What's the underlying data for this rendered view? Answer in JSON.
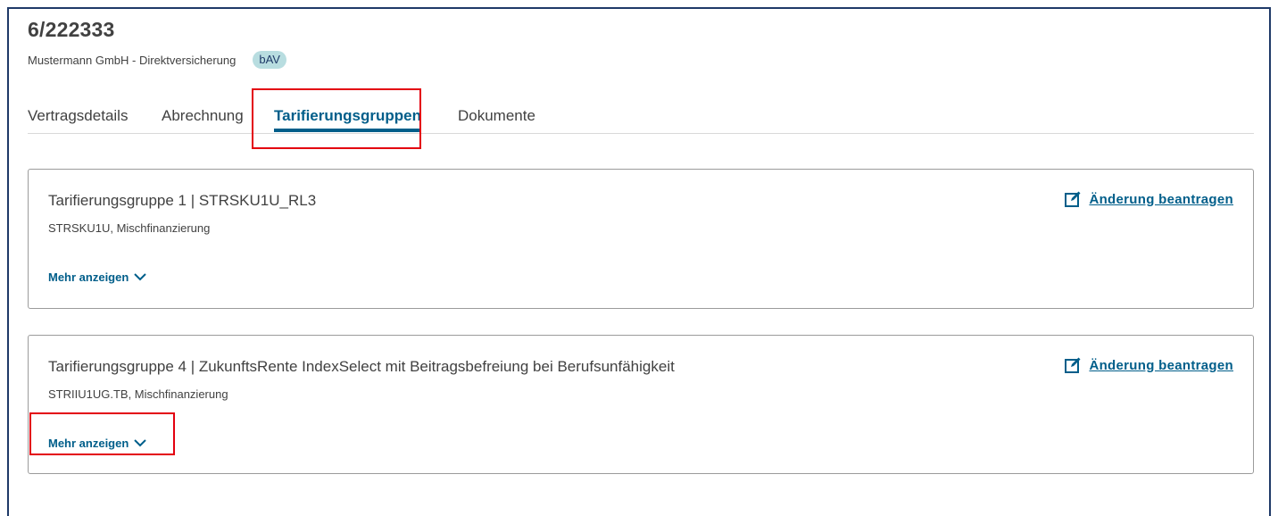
{
  "header": {
    "title": "6/222333",
    "subtitle": "Mustermann GmbH - Direktversicherung",
    "badge": "bAV"
  },
  "tabs": [
    {
      "label": "Vertragsdetails",
      "active": false
    },
    {
      "label": "Abrechnung",
      "active": false
    },
    {
      "label": "Tarifierungsgruppen",
      "active": true
    },
    {
      "label": "Dokumente",
      "active": false
    }
  ],
  "cards": [
    {
      "title": "Tarifierungsgruppe 1 | STRSKU1U_RL3",
      "subtitle": "STRSKU1U, Mischfinanzierung",
      "more_label": "Mehr anzeigen",
      "action_label": "Änderung beantragen"
    },
    {
      "title": "Tarifierungsgruppe 4 | ZukunftsRente IndexSelect mit Beitragsbefreiung bei Berufsunfähigkeit",
      "subtitle": "STRIIU1UG.TB, Mischfinanzierung",
      "more_label": "Mehr anzeigen",
      "action_label": "Änderung beantragen"
    }
  ],
  "icons": {
    "edit": "edit-icon",
    "chevron": "chevron-down-icon"
  },
  "colors": {
    "primary": "#005e8a",
    "badge_bg": "#b8dde0",
    "highlight": "#e3000f",
    "frame": "#1f3a68"
  }
}
